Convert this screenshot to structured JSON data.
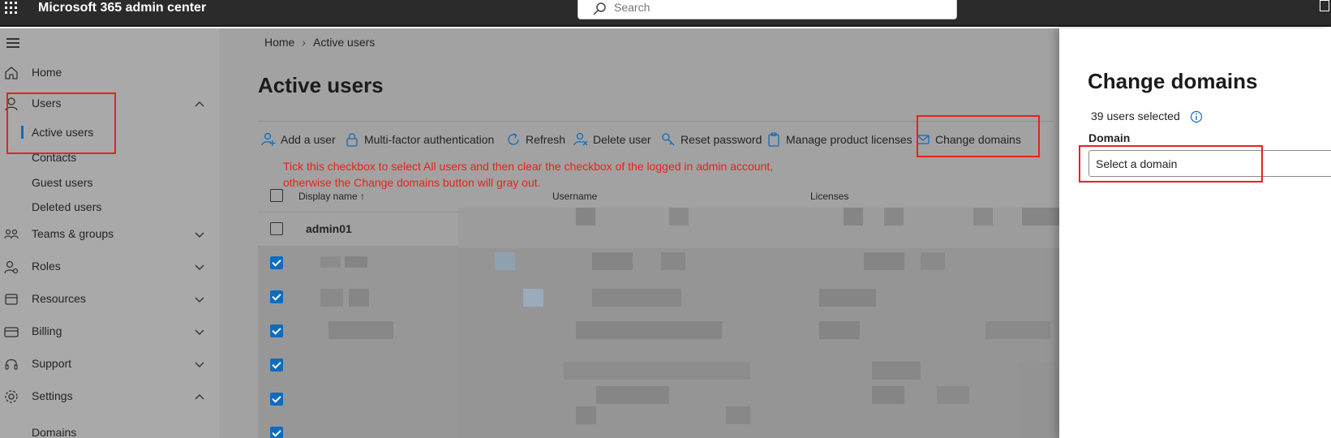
{
  "app": {
    "title": "Microsoft 365 admin center"
  },
  "search": {
    "placeholder": "Search"
  },
  "sidebar": {
    "items": [
      {
        "label": "Home"
      },
      {
        "label": "Users"
      },
      {
        "label": "Teams & groups"
      },
      {
        "label": "Roles"
      },
      {
        "label": "Resources"
      },
      {
        "label": "Billing"
      },
      {
        "label": "Support"
      },
      {
        "label": "Settings"
      }
    ],
    "users_sub": [
      "Active users",
      "Contacts",
      "Guest users",
      "Deleted users"
    ],
    "settings_sub": [
      "Domains"
    ]
  },
  "breadcrumb": {
    "home": "Home",
    "current": "Active users"
  },
  "page": {
    "title": "Active users"
  },
  "toolbar": {
    "add_user": "Add a user",
    "mfa": "Multi-factor authentication",
    "refresh": "Refresh",
    "delete_user": "Delete user",
    "reset_password": "Reset password",
    "manage_licenses": "Manage product licenses",
    "change_domains": "Change domains"
  },
  "annotation": {
    "line1": "Tick this checkbox to select All users and then clear the checkbox of the logged in admin account,",
    "line2": "otherwise the Change domains button will gray out."
  },
  "table": {
    "columns": {
      "display_name": "Display name",
      "sort_arrow": "↑",
      "username": "Username",
      "licenses": "Licenses"
    },
    "first_row_name": "admin01",
    "row_checked": [
      false,
      true,
      true,
      true,
      true,
      true,
      true
    ]
  },
  "panel": {
    "title": "Change domains",
    "users_selected": "39 users selected",
    "domain_label": "Domain",
    "domain_select_value": "Select a domain"
  },
  "colors": {
    "accent": "#0f6cbd",
    "annotation": "#e8221b",
    "topbar": "#2b2b2b"
  }
}
